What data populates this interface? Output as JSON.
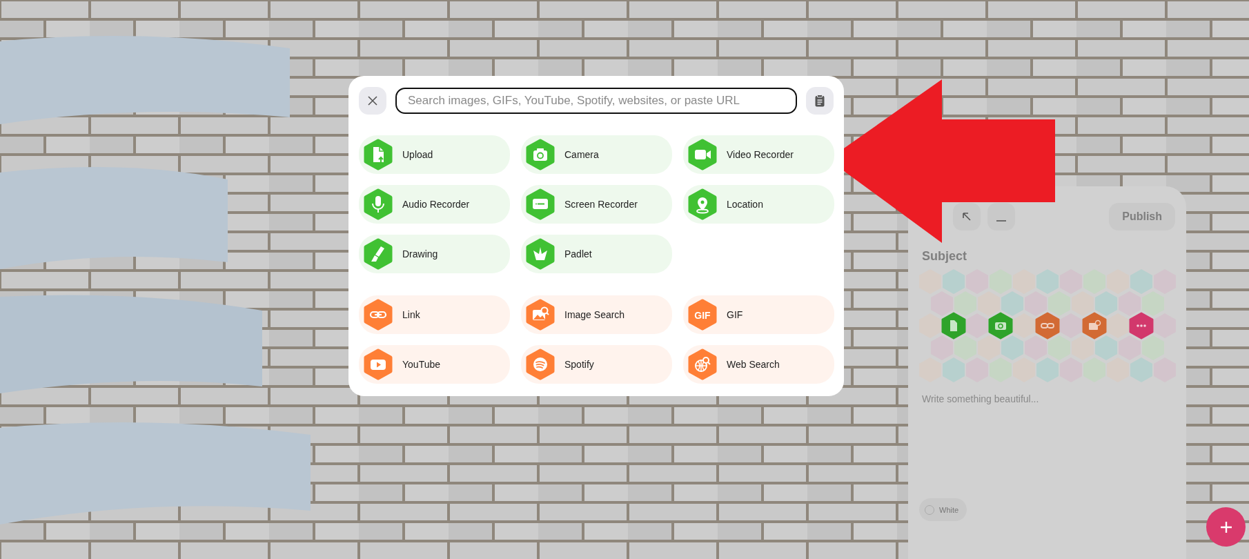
{
  "search": {
    "placeholder": "Search images, GIFs, YouTube, Spotify, websites, or paste URL"
  },
  "sections": [
    {
      "color": "#40c133",
      "items": [
        {
          "label": "Upload"
        },
        {
          "label": "Camera"
        },
        {
          "label": "Video Recorder"
        },
        {
          "label": "Audio Recorder"
        },
        {
          "label": "Screen Recorder"
        },
        {
          "label": "Location"
        },
        {
          "label": "Drawing"
        },
        {
          "label": "Padlet"
        }
      ]
    },
    {
      "color": "#ff7f36",
      "items": [
        {
          "label": "Link"
        },
        {
          "label": "Image Search"
        },
        {
          "label": "GIF",
          "icon_text": "GIF"
        },
        {
          "label": "YouTube"
        },
        {
          "label": "Spotify"
        },
        {
          "label": "Web Search"
        }
      ]
    }
  ],
  "composer": {
    "publish": "Publish",
    "subject_placeholder": "Subject",
    "body_placeholder": "Write something beautiful...",
    "color_option": {
      "label": "White",
      "selected": false
    }
  }
}
